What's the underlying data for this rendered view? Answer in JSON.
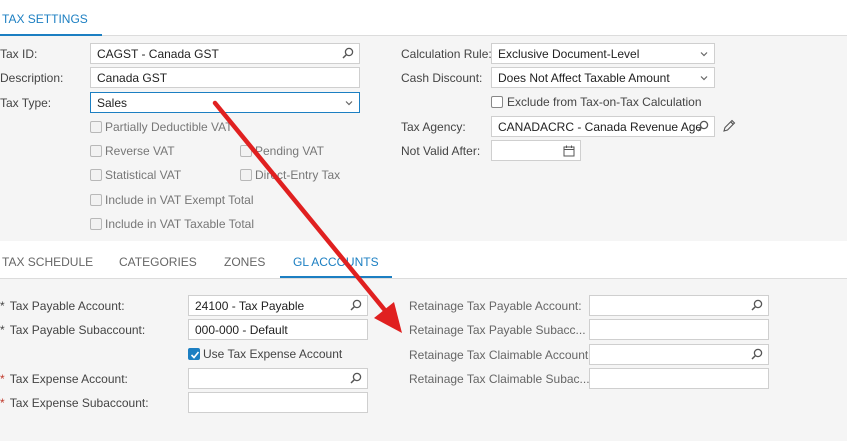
{
  "top_tab": {
    "label": "TAX SETTINGS"
  },
  "left": {
    "tax_id": {
      "label": "Tax ID:",
      "value": "CAGST - Canada GST"
    },
    "description": {
      "label": "Description:",
      "value": "Canada GST"
    },
    "tax_type": {
      "label": "Tax Type:",
      "value": "Sales"
    },
    "checkboxes": {
      "partially_deductible_vat": "Partially Deductible VAT",
      "reverse_vat": "Reverse VAT",
      "pending_vat": "Pending VAT",
      "statistical_vat": "Statistical VAT",
      "direct_entry_tax": "Direct-Entry Tax",
      "include_vat_exempt_total": "Include in VAT Exempt Total",
      "include_vat_taxable_total": "Include in VAT Taxable Total"
    }
  },
  "right": {
    "calculation_rule": {
      "label": "Calculation Rule:",
      "value": "Exclusive Document-Level"
    },
    "cash_discount": {
      "label": "Cash Discount:",
      "value": "Does Not Affect Taxable Amount"
    },
    "exclude_tax_on_tax": "Exclude from Tax-on-Tax Calculation",
    "tax_agency": {
      "label": "Tax Agency:",
      "value": "CANADACRC - Canada Revenue Age"
    },
    "not_valid_after": {
      "label": "Not Valid After:",
      "value": ""
    }
  },
  "tabs": [
    "TAX SCHEDULE",
    "CATEGORIES",
    "ZONES",
    "GL ACCOUNTS"
  ],
  "gl": {
    "tax_payable_account": {
      "label": "Tax Payable Account:",
      "value": "24100 - Tax Payable"
    },
    "tax_payable_subaccount": {
      "label": "Tax Payable Subaccount:",
      "value": "000-000 - Default"
    },
    "use_tax_expense_account": "Use Tax Expense Account",
    "tax_expense_account": {
      "label": "Tax Expense Account:",
      "value": ""
    },
    "tax_expense_subaccount": {
      "label": "Tax Expense Subaccount:",
      "value": ""
    },
    "retainage_tax_payable_account": {
      "label": "Retainage Tax Payable Account:",
      "value": ""
    },
    "retainage_tax_payable_subaccount": {
      "label": "Retainage Tax Payable Subacc...",
      "value": ""
    },
    "retainage_tax_claimable_account": {
      "label": "Retainage Tax Claimable Account:",
      "value": ""
    },
    "retainage_tax_claimable_subaccount": {
      "label": "Retainage Tax Claimable Subac...",
      "value": ""
    }
  },
  "required_marker": "*",
  "colors": {
    "accent": "#1c7fc2",
    "arrow": "#e02020",
    "required_red": "#c0392b",
    "panel_bg": "#f5f5f5"
  }
}
